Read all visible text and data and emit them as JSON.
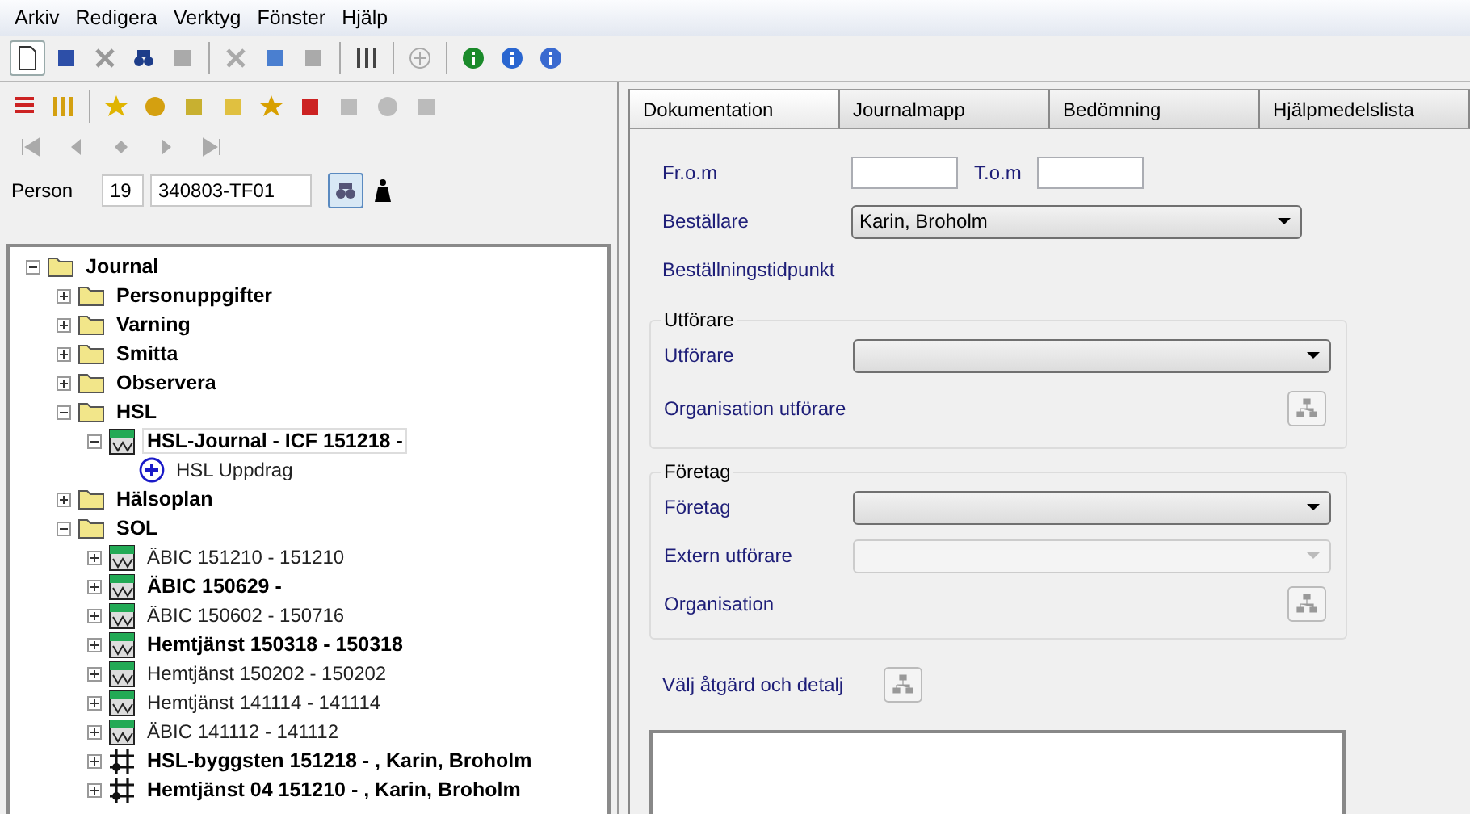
{
  "menu": [
    "Arkiv",
    "Redigera",
    "Verktyg",
    "Fönster",
    "Hjälp"
  ],
  "person": {
    "label": "Person",
    "century": "19",
    "id": "340803-TF01"
  },
  "tree": [
    {
      "label": "Journal",
      "kind": "folder",
      "bold": true,
      "expanded": true,
      "selected": false,
      "children": [
        {
          "label": "Personuppgifter",
          "kind": "folder",
          "bold": true,
          "expanded": false,
          "selected": false
        },
        {
          "label": "Varning",
          "kind": "folder",
          "bold": true,
          "expanded": false,
          "selected": false
        },
        {
          "label": "Smitta",
          "kind": "folder",
          "bold": true,
          "expanded": false,
          "selected": false
        },
        {
          "label": "Observera",
          "kind": "folder",
          "bold": true,
          "expanded": false,
          "selected": false
        },
        {
          "label": "HSL",
          "kind": "folder",
          "bold": true,
          "expanded": true,
          "selected": false,
          "children": [
            {
              "label": "HSL-Journal - ICF 151218 -",
              "kind": "record",
              "bold": true,
              "expanded": true,
              "selected": true,
              "children": [
                {
                  "label": "HSL Uppdrag",
                  "kind": "action",
                  "bold": false,
                  "selected": false
                }
              ]
            }
          ]
        },
        {
          "label": "Hälsoplan",
          "kind": "folder",
          "bold": true,
          "expanded": false,
          "selected": false
        },
        {
          "label": "SOL",
          "kind": "folder",
          "bold": true,
          "expanded": true,
          "selected": false,
          "children": [
            {
              "label": "ÄBIC 151210 - 151210",
              "kind": "record",
              "bold": false,
              "expanded": false,
              "selected": false
            },
            {
              "label": "ÄBIC 150629 -",
              "kind": "record",
              "bold": true,
              "expanded": false,
              "selected": false
            },
            {
              "label": "ÄBIC 150602 - 150716",
              "kind": "record",
              "bold": false,
              "expanded": false,
              "selected": false
            },
            {
              "label": "Hemtjänst 150318 - 150318",
              "kind": "record",
              "bold": true,
              "expanded": false,
              "selected": false
            },
            {
              "label": "Hemtjänst 150202 - 150202",
              "kind": "record",
              "bold": false,
              "expanded": false,
              "selected": false
            },
            {
              "label": "Hemtjänst 141114 - 141114",
              "kind": "record",
              "bold": false,
              "expanded": false,
              "selected": false
            },
            {
              "label": "ÄBIC 141112 - 141112",
              "kind": "record",
              "bold": false,
              "expanded": false,
              "selected": false
            },
            {
              "label": "HSL-byggsten 151218 - , Karin, Broholm",
              "kind": "note",
              "bold": true,
              "expanded": false,
              "selected": false
            },
            {
              "label": "Hemtjänst 04 151210 - , Karin, Broholm",
              "kind": "note",
              "bold": true,
              "expanded": false,
              "selected": false
            }
          ]
        }
      ]
    }
  ],
  "tabs": [
    {
      "label": "Dokumentation",
      "selected": true
    },
    {
      "label": "Journalmapp",
      "selected": false
    },
    {
      "label": "Bedömning",
      "selected": false
    },
    {
      "label": "Hjälpmedelslista",
      "selected": false
    }
  ],
  "form": {
    "from_label": "Fr.o.m",
    "to_label": "T.o.m",
    "orderer_label": "Beställare",
    "orderer_value": "Karin, Broholm",
    "order_time_label": "Beställningstidpunkt",
    "performer_group": {
      "title": "Utförare",
      "performer_label": "Utförare",
      "org_label": "Organisation utförare"
    },
    "company_group": {
      "title": "Företag",
      "company_label": "Företag",
      "external_label": "Extern utförare",
      "external_disabled": true,
      "org_label": "Organisation"
    },
    "action_label": "Välj åtgärd och detalj"
  }
}
